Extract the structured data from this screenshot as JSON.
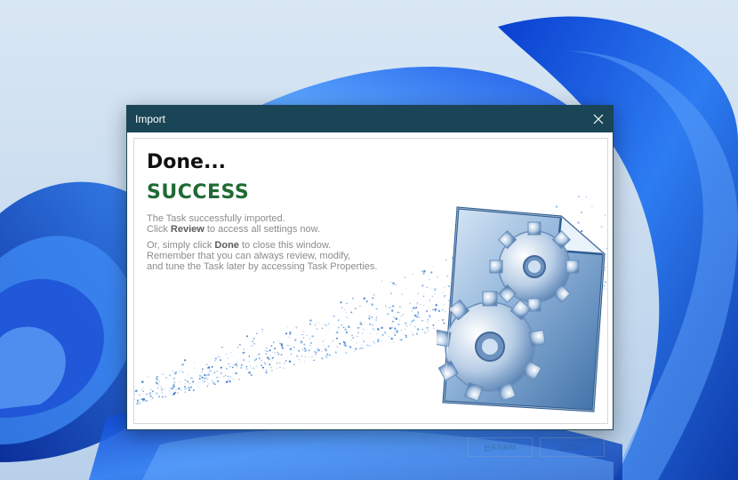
{
  "window": {
    "title": "Import"
  },
  "heading": "Done...",
  "status": "SUCCESS",
  "message": {
    "line1": "The Task successfully imported.",
    "line2_pre": "Click ",
    "line2_bold": "Review",
    "line2_post": " to access all settings now.",
    "line3_pre": "Or, simply click ",
    "line3_bold": "Done",
    "line3_post": " to close this window.",
    "line4": "Remember that you can always review, modify,",
    "line5": "and tune the Task later by accessing Task Properties."
  },
  "buttons": {
    "review": "Review",
    "done": "Done"
  },
  "colors": {
    "titlebar": "#1a4556",
    "success": "#1f6a33",
    "wallpaper_blue": "#1f5fe0",
    "accent_button": "#3b7fc9"
  },
  "icons": {
    "close": "close-icon",
    "art": "document-gears-icon"
  }
}
